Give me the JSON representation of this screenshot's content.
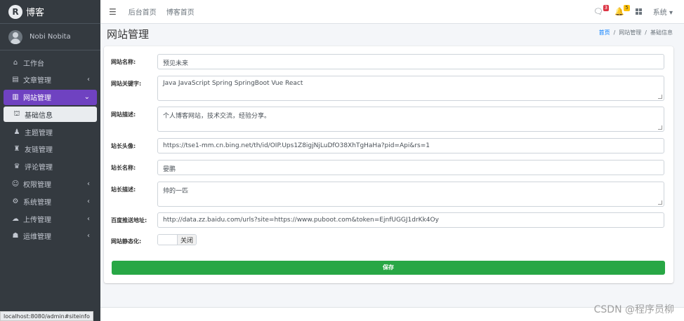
{
  "brand": {
    "logo_letter": "R",
    "name": "博客"
  },
  "user": {
    "name": "Nobi Nobita"
  },
  "sidebar": {
    "items": [
      {
        "label": "工作台",
        "icon": "home-icon",
        "chevron": ""
      },
      {
        "label": "文章管理",
        "icon": "article-icon",
        "chevron": "‹"
      },
      {
        "label": "网站管理",
        "icon": "website-icon",
        "chevron": "⌄"
      },
      {
        "label": "基础信息",
        "icon": "info-icon",
        "chevron": ""
      },
      {
        "label": "主题管理",
        "icon": "theme-icon",
        "chevron": ""
      },
      {
        "label": "友链管理",
        "icon": "link-icon",
        "chevron": ""
      },
      {
        "label": "评论管理",
        "icon": "comment-icon",
        "chevron": ""
      },
      {
        "label": "权限管理",
        "icon": "permission-icon",
        "chevron": "‹"
      },
      {
        "label": "系统管理",
        "icon": "gear-icon",
        "chevron": "‹"
      },
      {
        "label": "上传管理",
        "icon": "upload-icon",
        "chevron": "‹"
      },
      {
        "label": "运维管理",
        "icon": "ops-icon",
        "chevron": "‹"
      }
    ]
  },
  "topbar": {
    "menu_icon": "☰",
    "links": [
      "后台首页",
      "博客首页"
    ],
    "comment_badge": "3",
    "bell_badge": "5",
    "system_label": "系统"
  },
  "page": {
    "title": "网站管理",
    "breadcrumb": [
      "首页",
      "网站管理",
      "基础信息"
    ]
  },
  "form": {
    "site_name": {
      "label": "网站名称:",
      "value": "预见未来"
    },
    "site_keywords": {
      "label": "网站关键字:",
      "value": "Java JavaScript Spring SpringBoot Vue React"
    },
    "site_desc": {
      "label": "网站描述:",
      "value": "个人博客网站，技术交流，经验分享。"
    },
    "owner_avatar": {
      "label": "站长头像:",
      "value": "https://tse1-mm.cn.bing.net/th/id/OIP.Ups1Z8igjNjLuDfO38XhTgHaHa?pid=Api&rs=1"
    },
    "owner_name": {
      "label": "站长名称:",
      "value": "晏鹏"
    },
    "owner_desc": {
      "label": "站长描述:",
      "value": "帅的一匹"
    },
    "baidu_push": {
      "label": "百度推送地址:",
      "value": "http://data.zz.baidu.com/urls?site=https://www.puboot.com&token=EjnfUGGJ1drKk4Oy"
    },
    "static": {
      "label": "网站静态化:",
      "switch_label": "关闭"
    },
    "save_label": "保存"
  },
  "status_url": "localhost:8080/admin#siteinfo",
  "watermark": "CSDN @程序员柳",
  "colors": {
    "sidebar_bg": "#343a40",
    "active_nav": "#6f42c1",
    "save_button": "#28a745",
    "breadcrumb_link": "#007bff"
  }
}
